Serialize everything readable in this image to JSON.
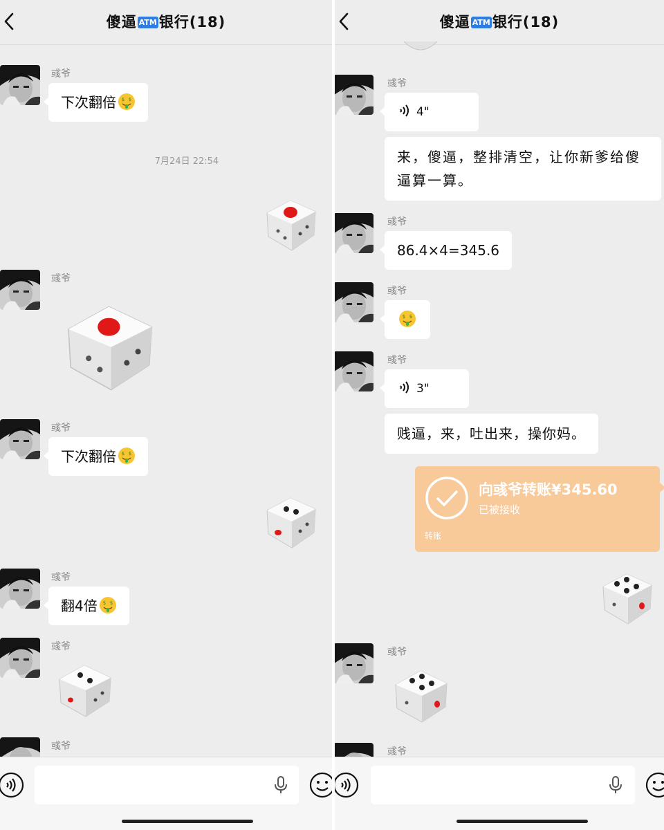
{
  "left_pane": {
    "title_prefix": "傻逼",
    "atm_badge": "ATM",
    "title_suffix": "银行(18)",
    "sender_name": "彧爷",
    "msg1": "下次翻倍",
    "timestamp": "7月24日  22:54",
    "msg2": "下次翻倍",
    "msg3": "翻4倍"
  },
  "right_pane": {
    "title_prefix": "傻逼",
    "atm_badge": "ATM",
    "title_suffix": "银行(18)",
    "sender_name": "彧爷",
    "voice1": "4\"",
    "msg_long": "来，傻逼，整排清空，让你新爹给傻逼算一算。",
    "msg_calc": "86.4×4=345.6",
    "voice2": "3\"",
    "msg_insult": "贱逼，来，吐出来，操你妈。",
    "transfer": {
      "title": "向彧爷转账¥345.60",
      "status": "已被接收",
      "footer": "转账"
    }
  },
  "colors": {
    "background": "#ededed",
    "bubble": "#ffffff",
    "transfer_card": "#f8c999",
    "dice_red": "#e01818",
    "atm_badge": "#2f7de1"
  },
  "icons": [
    "back-chevron-icon",
    "money-face-emoji-icon",
    "voice-icon",
    "mic-icon",
    "emoji-icon",
    "check-circle-icon",
    "dice-icon"
  ]
}
